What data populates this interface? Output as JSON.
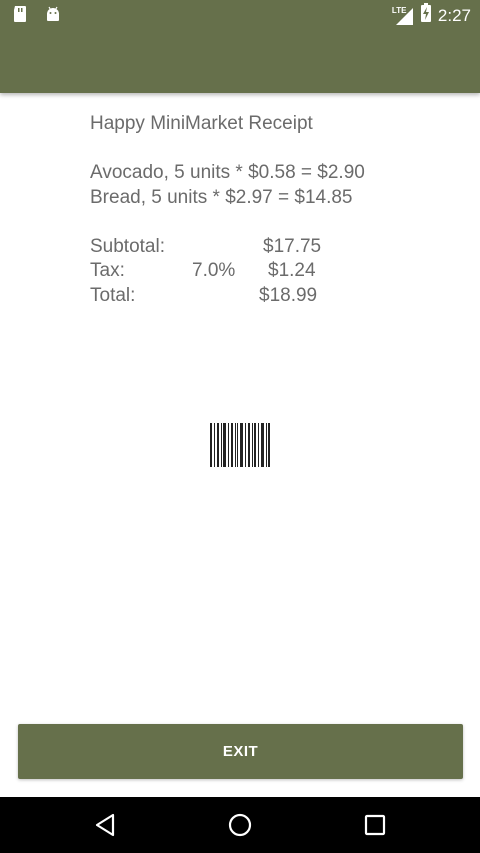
{
  "status_bar": {
    "time": "2:27",
    "network": "LTE",
    "icons": [
      "sd-card-icon",
      "android-icon",
      "lte-signal-icon",
      "battery-charging-icon"
    ]
  },
  "receipt": {
    "title": "Happy MiniMarket Receipt",
    "items": [
      "Avocado, 5 units * $0.58 = $2.90",
      "Bread, 5 units * $2.97 = $14.85"
    ],
    "subtotal": {
      "label": "Subtotal:",
      "amount": "$17.75"
    },
    "tax": {
      "label": "Tax:",
      "rate": "7.0%",
      "amount": "$1.24"
    },
    "total": {
      "label": "Total:",
      "amount": "$18.99"
    }
  },
  "barcode_icon": "barcode-icon",
  "exit_button": {
    "label": "EXIT"
  },
  "nav_bar": {
    "icons": [
      "back-icon",
      "home-icon",
      "recents-icon"
    ]
  },
  "colors": {
    "primary": "#66704b",
    "text": "#6b6b6b",
    "nav": "#000000"
  }
}
